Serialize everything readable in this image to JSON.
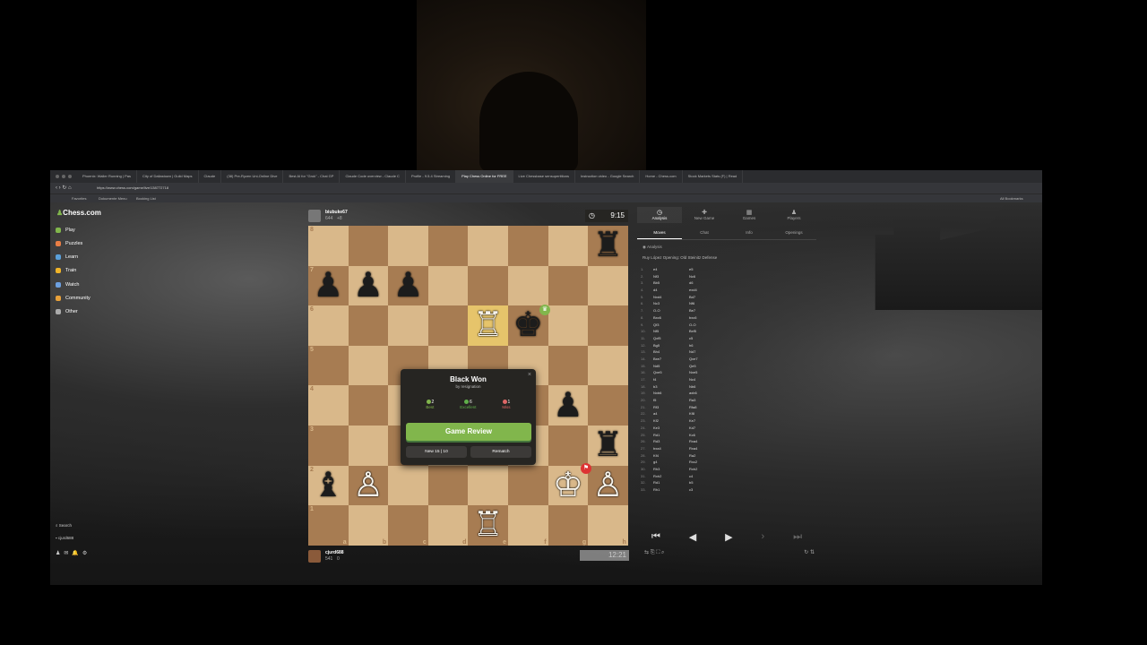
{
  "browser": {
    "tabs": [
      "Phoenix: Waller Running | Pas",
      "City of Dallastown | Guild Maps",
      "Claude",
      "(38) Pre-Ryzen Uni-Online Dive",
      "Best AI for \"Grok\" - Chat GP",
      "Claude Code overview - Claude C",
      "Profile - 9.5.4 Streaming",
      "Play Chess Online for FREE",
      "Live Chessbase sensupertitions",
      "Instruction video - Google Search",
      "Home - Chess.com",
      "Stock Markets Stats (F) | Read"
    ],
    "active_tab_index": 7,
    "url": "https://www.chess.com/game/live/138772718",
    "bookmarks": [
      "Favorites",
      "Dokumente Menu",
      "Booking List"
    ],
    "all_bookmarks": "All Bookmarks"
  },
  "sidebar": {
    "logo": "Chess.com",
    "items": [
      {
        "label": "Play",
        "icon": "play-icon",
        "color": "#81b64c"
      },
      {
        "label": "Puzzles",
        "icon": "puzzle-icon",
        "color": "#e97e45"
      },
      {
        "label": "Learn",
        "icon": "learn-icon",
        "color": "#5aa0d9"
      },
      {
        "label": "Train",
        "icon": "train-icon",
        "color": "#f0b429"
      },
      {
        "label": "Watch",
        "icon": "watch-icon",
        "color": "#6da0e0"
      },
      {
        "label": "Community",
        "icon": "community-icon",
        "color": "#e8a13a"
      },
      {
        "label": "Other",
        "icon": "more-icon",
        "color": "#aaaaaa"
      }
    ],
    "search": "Search",
    "username": "cjurd688"
  },
  "game": {
    "top_player": {
      "name": "biubuke67",
      "rating": "644",
      "delta": "+8",
      "clock": "9:15"
    },
    "bottom_player": {
      "name": "cjurd688",
      "rating": "541",
      "delta": "0",
      "clock": "12:21"
    },
    "files": [
      "a",
      "b",
      "c",
      "d",
      "e",
      "f",
      "g",
      "h"
    ],
    "ranks": [
      "8",
      "7",
      "6",
      "5",
      "4",
      "3",
      "2",
      "1"
    ]
  },
  "modal": {
    "title": "Black Won",
    "subtitle": "by resignation",
    "stats": [
      {
        "count": "2",
        "label": "Best",
        "color": "#81b64c"
      },
      {
        "count": "6",
        "label": "Excellent",
        "color": "#5fb04a"
      },
      {
        "count": "1",
        "label": "Miss",
        "color": "#e06666"
      }
    ],
    "game_review": "Game Review",
    "new_game": "New 15 | 10",
    "rematch": "Rematch"
  },
  "panel": {
    "tabs": [
      "Analysis",
      "New Game",
      "Games",
      "Players"
    ],
    "subtabs": [
      "Moves",
      "Chat",
      "Info",
      "Openings"
    ],
    "opening": "Ruy López Opening: Old Steinitz Defense",
    "analysis_label": "Analysis",
    "moves": [
      [
        "1.",
        "e4",
        "e5"
      ],
      [
        "2.",
        "Nf3",
        "Nc6"
      ],
      [
        "3.",
        "Bb5",
        "d6"
      ],
      [
        "4.",
        "d4",
        "exd4"
      ],
      [
        "5.",
        "Nxd4",
        "Bd7"
      ],
      [
        "6.",
        "Nc3",
        "Nf6"
      ],
      [
        "7.",
        "O-O",
        "Be7"
      ],
      [
        "8.",
        "Bxc6",
        "bxc6"
      ],
      [
        "9.",
        "Qf3",
        "O-O"
      ],
      [
        "10.",
        "Nf5",
        "Bxf5"
      ],
      [
        "11.",
        "Qxf5",
        "c5"
      ],
      [
        "12.",
        "Bg5",
        "h6"
      ],
      [
        "13.",
        "Bh4",
        "Nd7"
      ],
      [
        "14.",
        "Bxe7",
        "Qxe7"
      ],
      [
        "15.",
        "Nd5",
        "Qe5"
      ],
      [
        "16.",
        "Qxe5",
        "Nxe5"
      ],
      [
        "17.",
        "f4",
        "Nc4"
      ],
      [
        "18.",
        "b3",
        "Nb6"
      ],
      [
        "19.",
        "Nxb6",
        "axb6"
      ],
      [
        "20.",
        "f5",
        "Ra3"
      ],
      [
        "21.",
        "Rf3",
        "Rfa8"
      ],
      [
        "22.",
        "a4",
        "Kf8"
      ],
      [
        "23.",
        "Kf2",
        "Ke7"
      ],
      [
        "24.",
        "Ke3",
        "Kd7"
      ],
      [
        "25.",
        "Rd1",
        "Kc6"
      ],
      [
        "26.",
        "Rd3",
        "Rxa4"
      ],
      [
        "27.",
        "bxa4",
        "Rxa4"
      ],
      [
        "28.",
        "Kf4",
        "Ra2"
      ],
      [
        "29.",
        "g4",
        "Rxc2"
      ],
      [
        "30.",
        "Rh3",
        "Rxh2"
      ],
      [
        "31.",
        "Rxh2",
        "c4"
      ],
      [
        "32.",
        "Rd1",
        "b5"
      ],
      [
        "33.",
        "Rh1",
        "c3"
      ]
    ]
  }
}
